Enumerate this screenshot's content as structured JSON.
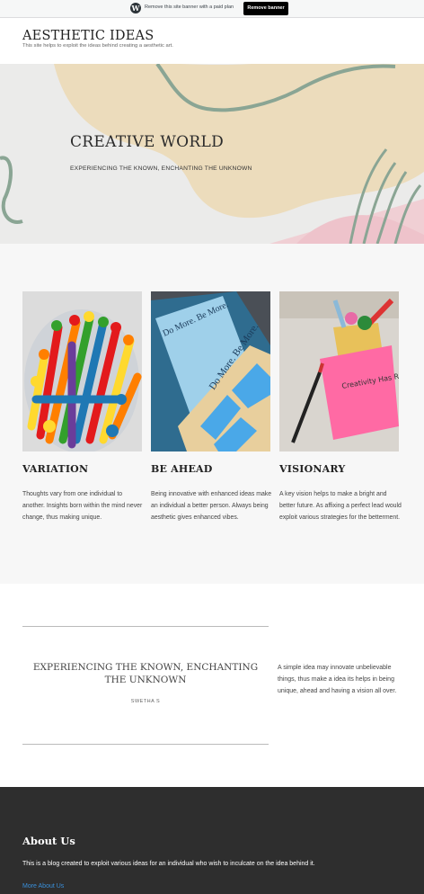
{
  "banner": {
    "text": "Remove this site banner with a paid plan",
    "button_label": "Remove banner",
    "logo_icon": "wordpress-logo-icon"
  },
  "header": {
    "title": "AESTHETIC IDEAS",
    "tagline": "This site helps to exploit the ideas behind creating a aesthetic art."
  },
  "hero": {
    "title": "CREATIVE WORLD",
    "subtitle": "EXPERIENCING THE KNOWN, ENCHANTING THE UNKNOWN"
  },
  "features": [
    {
      "title": "VARIATION",
      "text": "Thoughts vary from one individual to another. Insights born within the mind never change, thus making unique.",
      "image": "colored-markers-photo"
    },
    {
      "title": "BE AHEAD",
      "text": "Being innovative with enhanced ideas make an individual a better person. Always being aesthetic gives enhanced vibes.",
      "image": "do-more-be-more-notebooks-photo",
      "image_text": "Do More. Be More."
    },
    {
      "title": "VISIONARY",
      "text": "A key vision helps to make a bright and better future. As affixing a perfect lead would exploit various strategies for the betterment.",
      "image": "sticky-note-pen-holder-photo",
      "image_text": "Creativity Has Rule"
    }
  ],
  "quote": {
    "text": "EXPERIENCING THE KNOWN, ENCHANTING THE UNKNOWN",
    "author": "SWETHA S",
    "side_text": "A simple idea may innovate unbelievable things, thus make a idea its helps in being unique, ahead and having a vision all over."
  },
  "footer": {
    "title": "About Us",
    "text": "This is a blog created to exploit various ideas for an individual who wish to inculcate on the idea behind it.",
    "link_label": "More About Us"
  }
}
